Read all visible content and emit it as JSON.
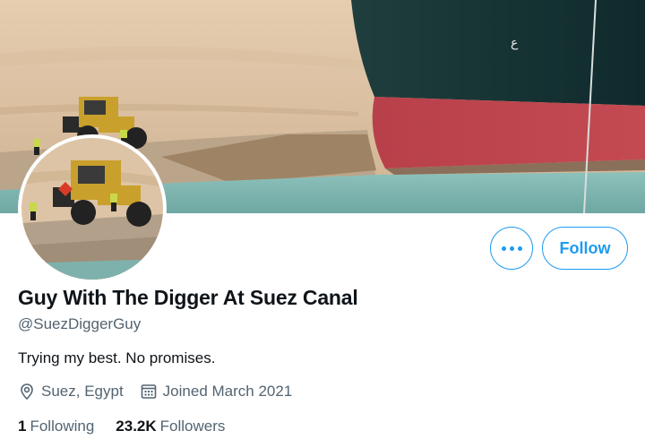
{
  "profile": {
    "display_name": "Guy With The Digger At Suez Canal",
    "handle": "@SuezDiggerGuy",
    "bio": "Trying my best. No promises.",
    "location": "Suez, Egypt",
    "joined": "Joined March 2021"
  },
  "stats": {
    "following_count": "1",
    "following_label": "Following",
    "followers_count": "23.2K",
    "followers_label": "Followers"
  },
  "actions": {
    "follow_label": "Follow"
  },
  "icons": {
    "more": "more-dots-icon",
    "location": "location-pin-icon",
    "calendar": "calendar-icon"
  },
  "colors": {
    "accent": "#1d9bf0",
    "text_primary": "#0f1419",
    "text_secondary": "#536471"
  }
}
